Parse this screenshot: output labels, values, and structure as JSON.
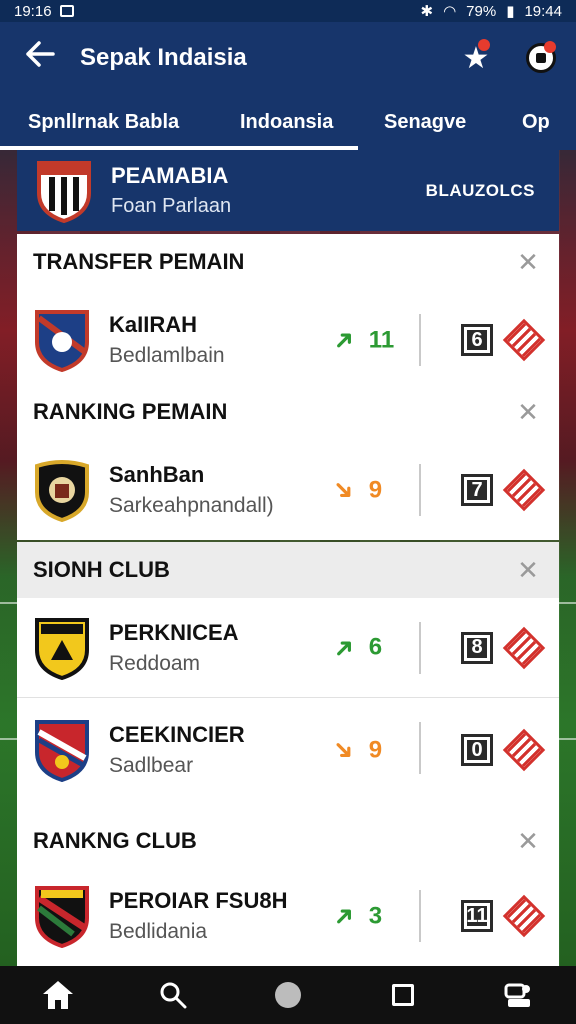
{
  "status_bar": {
    "time_left": "19:16",
    "battery": "79%",
    "time_right": "19:44"
  },
  "app_bar": {
    "title": "Sepak Indaisia"
  },
  "tabs": [
    {
      "label": "Spnllrnak Babla"
    },
    {
      "label": "Indoansia"
    },
    {
      "label": "Senagve"
    },
    {
      "label": "Op"
    }
  ],
  "club_header": {
    "name": "PEAMABIA",
    "subtitle": "Foan Parlaan",
    "code": "BLAUZOLCS"
  },
  "sections": [
    {
      "title": "TRANSFER PEMAIN",
      "rows": [
        {
          "name": "KaIIRAH",
          "detail": "Bedlamlbain",
          "trend": "up",
          "value": "11",
          "icon_value": "6"
        }
      ]
    },
    {
      "title": "RANKING PEMAIN",
      "rows": [
        {
          "name": "SanhBan",
          "detail": "Sarkeahpnandall)",
          "trend": "down",
          "value": "9",
          "icon_value": "7"
        }
      ]
    },
    {
      "title": "SIONH CLUB",
      "rows": [
        {
          "name": "PERKNICEA",
          "detail": "Reddoam",
          "trend": "up",
          "value": "6",
          "icon_value": "8"
        },
        {
          "name": "CEEKINCIER",
          "detail": "Sadlbear",
          "trend": "down",
          "value": "9",
          "icon_value": "0"
        }
      ]
    },
    {
      "title": "RANKNG CLUB",
      "rows": [
        {
          "name": "PEROIAR FSU8H",
          "detail": "Bedlidania",
          "trend": "up",
          "value": "3",
          "icon_value": "11"
        }
      ]
    }
  ],
  "colors": {
    "primary": "#17356b",
    "up": "#2c9a33",
    "down": "#f08a24",
    "alert": "#d3322d"
  },
  "icons": {
    "back": "arrow-left-icon",
    "star": "star-icon",
    "ball": "soccer-ball-icon",
    "close": "close-icon",
    "home": "home-icon",
    "search": "search-icon",
    "circle": "circle-icon",
    "square": "square-icon",
    "settings": "settings-icon"
  }
}
